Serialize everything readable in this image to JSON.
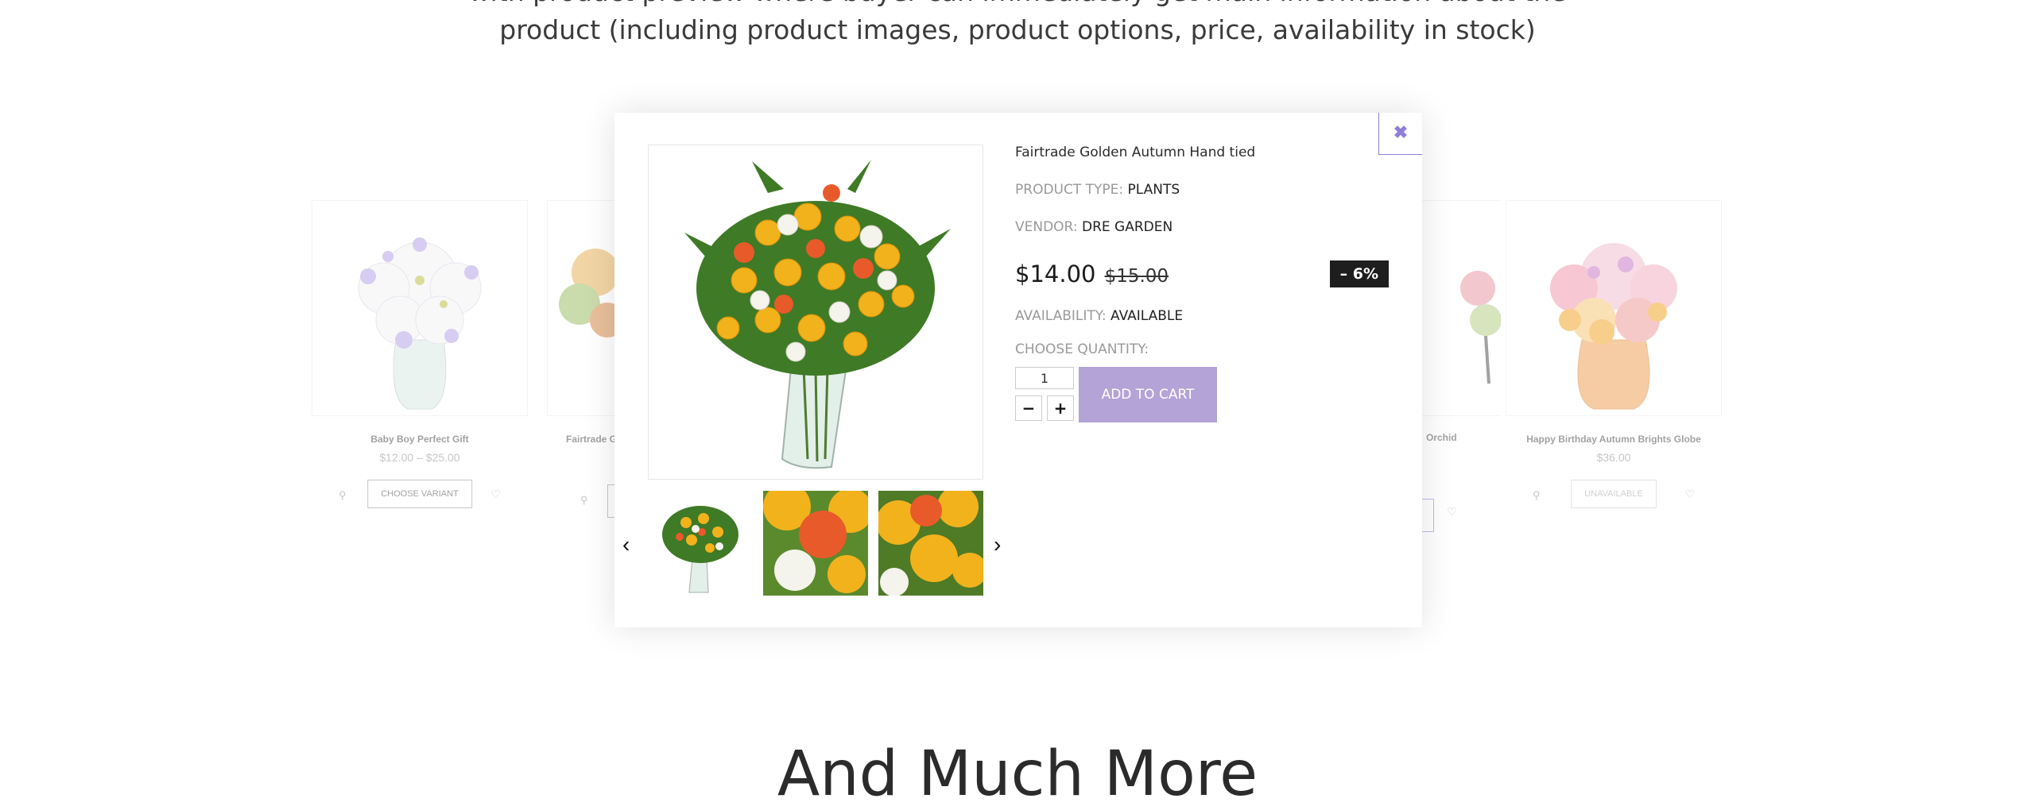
{
  "intro": {
    "line1": "with product preview where buyer can immediately get main information about the",
    "line2": "product (including product images, product options, price, availability in stock)"
  },
  "background_products": [
    {
      "name": "Baby Boy Perfect Gift",
      "price": "$12.00 – $25.00",
      "button": "CHOOSE VARIANT"
    },
    {
      "name": "Fairtrade G",
      "price": "",
      "button": ""
    },
    {
      "name": "Orchid",
      "price": "",
      "button": ""
    },
    {
      "name": "Happy Birthday Autumn Brights Globe",
      "price": "$36.00",
      "button": "UNAVAILABLE"
    }
  ],
  "modal": {
    "close_icon": "close-icon",
    "title": "Fairtrade Golden Autumn Hand tied",
    "product_type_label": "PRODUCT TYPE:",
    "product_type": "PLANTS",
    "vendor_label": "VENDOR:",
    "vendor": "DRE GARDEN",
    "price": "$14.00",
    "old_price": "$15.00",
    "discount": "– 6%",
    "availability_label": "AVAILABILITY:",
    "availability": "AVAILABLE",
    "quantity_label": "CHOOSE QUANTITY:",
    "quantity": "1",
    "minus": "−",
    "plus": "+",
    "add_to_cart": "ADD TO CART",
    "prev_icon": "chevron-left-icon",
    "next_icon": "chevron-right-icon"
  },
  "section_heading": "And Much More",
  "colors": {
    "accent": "#8f7fd6",
    "cart_button": "#b3a3d6",
    "badge": "#1e1e1e"
  }
}
